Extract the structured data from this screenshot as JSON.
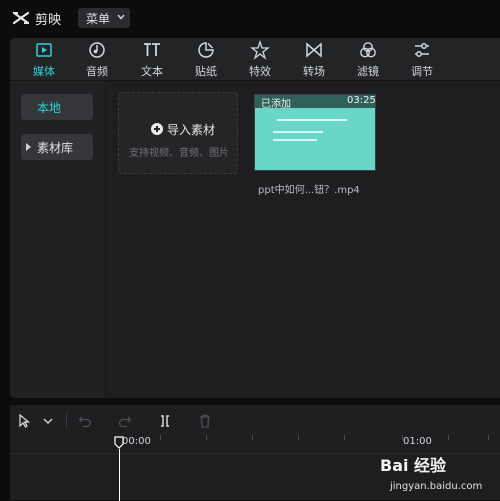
{
  "titlebar": {
    "app_name": "剪映",
    "menu_label": "菜单"
  },
  "tabs": [
    {
      "label": "媒体",
      "icon": "media-icon",
      "active": true
    },
    {
      "label": "音频",
      "icon": "audio-icon",
      "active": false
    },
    {
      "label": "文本",
      "icon": "text-icon",
      "active": false
    },
    {
      "label": "贴纸",
      "icon": "sticker-icon",
      "active": false
    },
    {
      "label": "特效",
      "icon": "effects-icon",
      "active": false
    },
    {
      "label": "转场",
      "icon": "transition-icon",
      "active": false
    },
    {
      "label": "滤镜",
      "icon": "filter-icon",
      "active": false
    },
    {
      "label": "调节",
      "icon": "adjust-icon",
      "active": false
    }
  ],
  "sidebar": {
    "local_label": "本地",
    "library_label": "素材库"
  },
  "import_card": {
    "title": "导入素材",
    "subtitle": "支持视频、音频、图片"
  },
  "media_item": {
    "badge": "已添加",
    "duration": "03:25",
    "filename": "ppt中如何...钮？.mp4"
  },
  "timeline": {
    "time_start": "00:00",
    "time_mark": "01:00"
  },
  "watermark": {
    "brand": "Bai 经验",
    "url": "jingyan.baidu.com"
  },
  "colors": {
    "accent": "#2fd2d6",
    "background": "#0c0c0d",
    "panel": "#1e1e20",
    "thumbnail": "#6ad6c7"
  }
}
